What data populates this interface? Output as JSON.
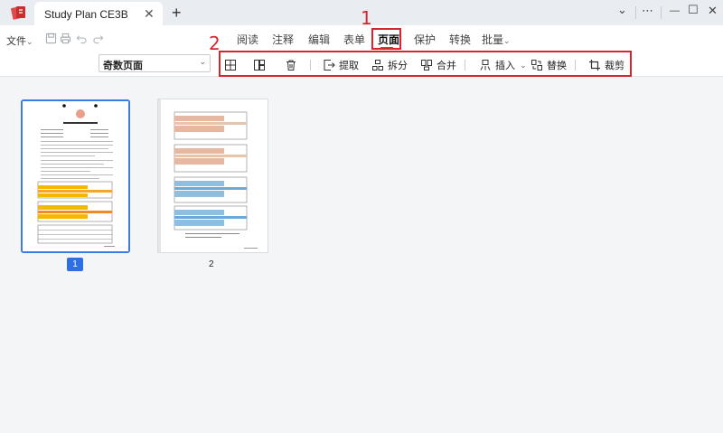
{
  "window": {
    "tab_title": "Study Plan CE3B",
    "tab_close": "✕",
    "new_tab": "+",
    "controls": {
      "more": "⋯",
      "menu": "⌄",
      "minimize": "—",
      "maximize": "☐",
      "close": "✕"
    }
  },
  "menu": {
    "file_label": "文件",
    "file_caret": "⌄",
    "ribbon_tabs": [
      "阅读",
      "注释",
      "编辑",
      "表单",
      "页面",
      "保护",
      "转换",
      "批量"
    ],
    "batch_caret": "⌄",
    "active_tab": "页面"
  },
  "toolbar": {
    "page_filter": {
      "value": "奇数页面",
      "caret": "⌄"
    },
    "tools": {
      "extract": "提取",
      "split": "拆分",
      "merge": "合并",
      "insert": "插入",
      "insert_caret": "⌄",
      "replace": "替换",
      "crop": "裁剪"
    }
  },
  "annotations": {
    "step1": "1",
    "step2": "2",
    "color": "#d3262f"
  },
  "pages": [
    {
      "number": "1",
      "selected": true
    },
    {
      "number": "2",
      "selected": false
    }
  ],
  "colors": {
    "accent": "#2f6fe4",
    "selected_border": "#3b7be8",
    "brand_red": "#d63a3a"
  }
}
